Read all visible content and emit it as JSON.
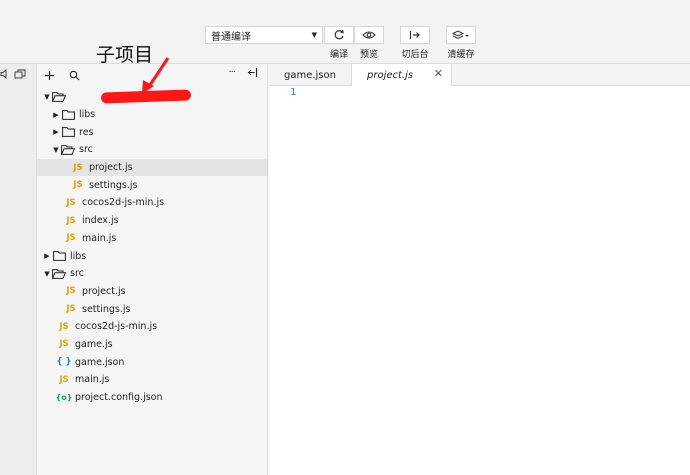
{
  "toolbar": {
    "mode_select": {
      "value": "普通编译"
    },
    "buttons": [
      {
        "label": "编译",
        "icon": "refresh-icon"
      },
      {
        "label": "预览",
        "icon": "eye-icon"
      },
      {
        "label": "切后台",
        "icon": "switch-background-icon"
      },
      {
        "label": "清缓存",
        "icon": "layers-icon"
      }
    ]
  },
  "annotation": {
    "text": "子项目",
    "color": "#ff1616"
  },
  "explorer": {
    "tree": [
      {
        "label": "",
        "type": "folder-open",
        "depth": 0,
        "expanded": true,
        "redacted": true
      },
      {
        "label": "libs",
        "type": "folder",
        "depth": 1,
        "expanded": false
      },
      {
        "label": "res",
        "type": "folder",
        "depth": 1,
        "expanded": false
      },
      {
        "label": "src",
        "type": "folder-open",
        "depth": 1,
        "expanded": true
      },
      {
        "label": "project.js",
        "type": "js",
        "depth": 2,
        "selected": true
      },
      {
        "label": "settings.js",
        "type": "js",
        "depth": 2
      },
      {
        "label": "cocos2d-js-min.js",
        "type": "js",
        "depth": 1
      },
      {
        "label": "index.js",
        "type": "js",
        "depth": 1
      },
      {
        "label": "main.js",
        "type": "js",
        "depth": 1
      },
      {
        "label": "libs",
        "type": "folder",
        "depth": 0,
        "expanded": false
      },
      {
        "label": "src",
        "type": "folder-open",
        "depth": 0,
        "expanded": true
      },
      {
        "label": "project.js",
        "type": "js",
        "depth": 1
      },
      {
        "label": "settings.js",
        "type": "js",
        "depth": 1
      },
      {
        "label": "cocos2d-js-min.js",
        "type": "js",
        "depth": 0
      },
      {
        "label": "game.js",
        "type": "js",
        "depth": 0
      },
      {
        "label": "game.json",
        "type": "json",
        "depth": 0
      },
      {
        "label": "main.js",
        "type": "js",
        "depth": 0
      },
      {
        "label": "project.config.json",
        "type": "config",
        "depth": 0
      }
    ]
  },
  "editor": {
    "tabs": [
      {
        "label": "game.json",
        "active": false
      },
      {
        "label": "project.js",
        "active": true
      }
    ],
    "line_numbers": [
      "1"
    ]
  },
  "colors": {
    "js_icon": "#e6a100",
    "json_icon": "#1f7bd8",
    "config_icon": "#18a05c",
    "line_number": "#2d6ad0"
  }
}
